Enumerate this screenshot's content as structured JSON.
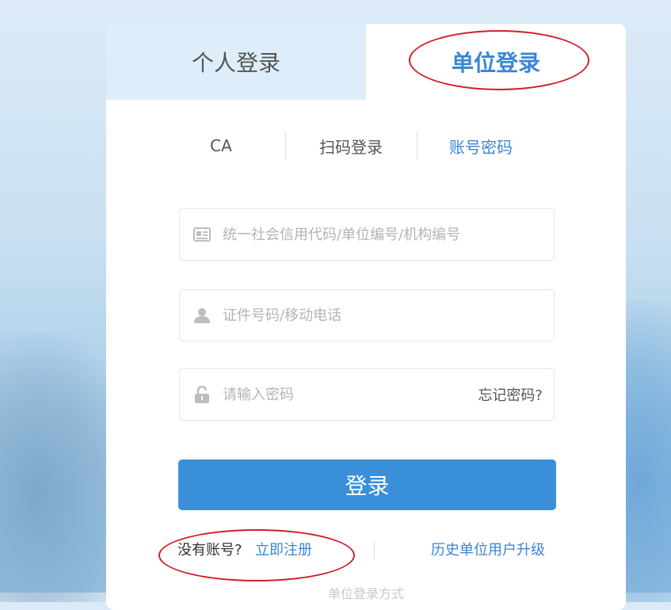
{
  "tabs": {
    "personal_label": "个人登录",
    "unit_label": "单位登录"
  },
  "subtabs": {
    "ca_label": "CA",
    "scan_label": "扫码登录",
    "account_label": "账号密码"
  },
  "form": {
    "org_code_placeholder": "统一社会信用代码/单位编号/机构编号",
    "id_phone_placeholder": "证件号码/移动电话",
    "password_placeholder": "请输入密码",
    "forgot_label": "忘记密码?",
    "login_label": "登录"
  },
  "footer": {
    "no_account_label": "没有账号?",
    "register_label": "立即注册",
    "history_label": "历史单位用户升级",
    "cutoff_label": "单位登录方式"
  },
  "colors": {
    "accent": "#3a8fd9",
    "link": "#3b86d4",
    "annotation": "#d0202a",
    "inactive_tab_bg": "#ddeefa"
  },
  "icons": {
    "org": "id-card-icon",
    "user": "user-icon",
    "lock": "lock-icon"
  }
}
